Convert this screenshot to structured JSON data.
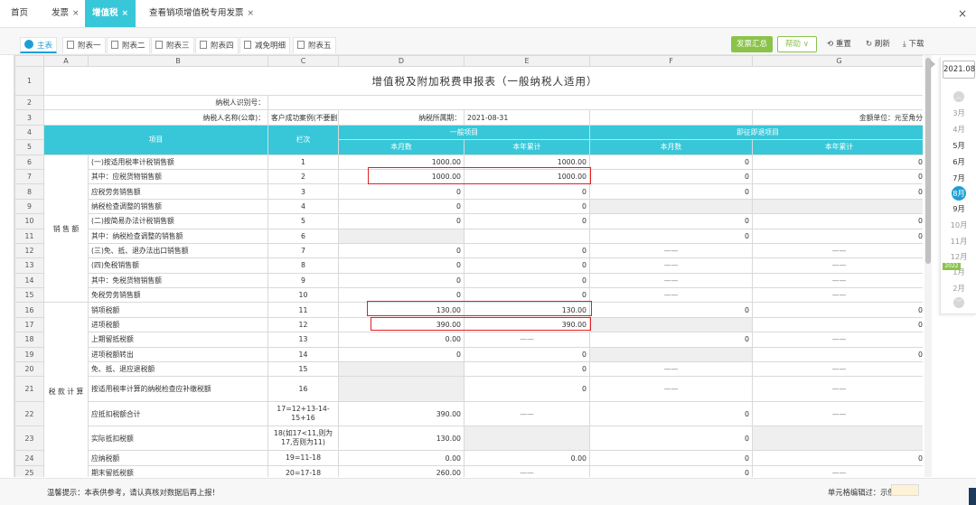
{
  "topbar": {
    "tabs": [
      {
        "label": "首页",
        "close": ""
      },
      {
        "label": "发票",
        "close": "×"
      },
      {
        "label": "增值税",
        "close": "×"
      },
      {
        "label": "查看销项增值税专用发票",
        "close": "×"
      }
    ],
    "window_close": "×"
  },
  "subtabs": [
    "主表",
    "附表一",
    "附表二",
    "附表三",
    "附表四",
    "减免明细",
    "附表五"
  ],
  "toolbar": {
    "summary_button": "发票汇总",
    "help_button": "帮助 ∨",
    "reset_button": "重置",
    "refresh_button": "刷新",
    "download_button": "下载",
    "summary_color": "#8bc34a"
  },
  "sheet": {
    "col_letters": [
      "A",
      "B",
      "C",
      "D",
      "E",
      "F",
      "G"
    ],
    "title": "增值税及附加税费申报表（一般纳税人适用）",
    "taxpayer_id_label": "纳税人识别号：",
    "taxpayer_name_label": "纳税人名称(公章)：",
    "taxpayer_name": "客户成功案例(不要删)",
    "period_label": "纳税所属期：",
    "period": "2021-08-31",
    "unit_label": "金额单位：元至角分",
    "hdr_item": "项目",
    "hdr_col": "栏次",
    "hdr_general": "一般项目",
    "hdr_immediate": "即征即退项目",
    "hdr_month": "本月数",
    "hdr_year": "本年累计",
    "group_sales": "销 售 额",
    "group_tax": "税 款 计 算",
    "dash": "——",
    "header_color": "#38c7d8",
    "rows": [
      {
        "rn": "6",
        "item": "(一)按适用税率计税销售额",
        "col": "1",
        "d": "1000.00",
        "e": "1000.00",
        "f": "0",
        "g": "0"
      },
      {
        "rn": "7",
        "item": "其中：应税货物销售额",
        "col": "2",
        "d": "1000.00",
        "e": "1000.00",
        "f": "0",
        "g": "0"
      },
      {
        "rn": "8",
        "item": "应税劳务销售额",
        "col": "3",
        "d": "0",
        "e": "0",
        "f": "0",
        "g": "0"
      },
      {
        "rn": "9",
        "item": "纳税检查调整的销售额",
        "col": "4",
        "d": "0",
        "e": "0",
        "f": "",
        "g": ""
      },
      {
        "rn": "10",
        "item": "(二)按简易办法计税销售额",
        "col": "5",
        "d": "0",
        "e": "0",
        "f": "0",
        "g": "0"
      },
      {
        "rn": "11",
        "item": "其中：纳税检查调整的销售额",
        "col": "6",
        "d": "",
        "e": "",
        "f": "0",
        "g": "0"
      },
      {
        "rn": "12",
        "item": "(三)免、抵、退办法出口销售额",
        "col": "7",
        "d": "0",
        "e": "0",
        "f": "——",
        "g": "——"
      },
      {
        "rn": "13",
        "item": "(四)免税销售额",
        "col": "8",
        "d": "0",
        "e": "0",
        "f": "——",
        "g": "——"
      },
      {
        "rn": "14",
        "item": "其中：免税货物销售额",
        "col": "9",
        "d": "0",
        "e": "0",
        "f": "——",
        "g": "——"
      },
      {
        "rn": "15",
        "item": "免税劳务销售额",
        "col": "10",
        "d": "0",
        "e": "0",
        "f": "——",
        "g": "——"
      },
      {
        "rn": "16",
        "item": "销项税额",
        "col": "11",
        "d": "130.00",
        "e": "130.00",
        "f": "0",
        "g": "0"
      },
      {
        "rn": "17",
        "item": "进项税额",
        "col": "12",
        "d": "390.00",
        "e": "390.00",
        "f": "",
        "g": "0"
      },
      {
        "rn": "18",
        "item": "上期留抵税额",
        "col": "13",
        "d": "0.00",
        "e": "——",
        "f": "0",
        "g": "——"
      },
      {
        "rn": "19",
        "item": "进项税额转出",
        "col": "14",
        "d": "0",
        "e": "0",
        "f": "",
        "g": "0"
      },
      {
        "rn": "20",
        "item": "免、抵、退应退税额",
        "col": "15",
        "d": "",
        "e": "0",
        "f": "——",
        "g": "——"
      },
      {
        "rn": "21",
        "item": "按适用税率计算的纳税检查应补缴税额",
        "col": "16",
        "d": "",
        "e": "0",
        "f": "——",
        "g": "——"
      },
      {
        "rn": "22",
        "item": "应抵扣税额合计",
        "col": "17=12+13-14-15+16",
        "d": "390.00",
        "e": "——",
        "f": "0",
        "g": "——"
      },
      {
        "rn": "23",
        "item": "实际抵扣税额",
        "col": "18(如17<11,则为17,否则为11)",
        "d": "130.00",
        "e": "",
        "f": "0",
        "g": ""
      },
      {
        "rn": "24",
        "item": "应纳税额",
        "col": "19=11-18",
        "d": "0.00",
        "e": "0.00",
        "f": "0",
        "g": "0"
      },
      {
        "rn": "25",
        "item": "期末留抵税额",
        "col": "20=17-18",
        "d": "260.00",
        "e": "——",
        "f": "0",
        "g": "——"
      }
    ]
  },
  "footer": {
    "tip": "温馨提示：本表供参考，请认真核对数据后再上报！",
    "legend": "单元格编辑过：示例"
  },
  "date_panel": {
    "selected_date": "2021.08",
    "year_badge": "2022",
    "months": [
      "3月",
      "4月",
      "5月",
      "6月",
      "7月",
      "8月",
      "9月",
      "10月",
      "11月",
      "12月",
      "1月",
      "2月"
    ]
  }
}
